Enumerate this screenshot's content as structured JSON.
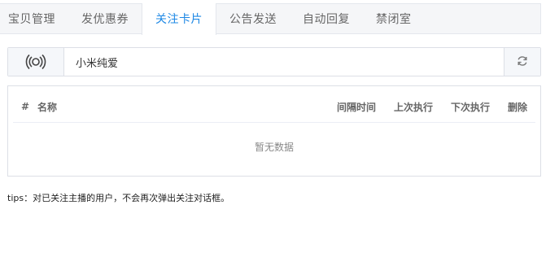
{
  "tabs": [
    {
      "label": "宝贝管理"
    },
    {
      "label": "发优惠券"
    },
    {
      "label": "关注卡片",
      "active": true
    },
    {
      "label": "公告发送"
    },
    {
      "label": "自动回复"
    },
    {
      "label": "禁闭室"
    }
  ],
  "search": {
    "value": "小米纯爱",
    "prefix_icon": "broadcast-icon",
    "suffix_icon": "refresh-icon"
  },
  "table": {
    "columns": {
      "hash": "#",
      "name": "名称",
      "interval": "间隔时间",
      "last": "上次执行",
      "next": "下次执行",
      "delete": "删除"
    },
    "empty_text": "暂无数据"
  },
  "tips": "tips：对已关注主播的用户，不会再次弹出关注对话框。",
  "colors": {
    "accent": "#1e88e5"
  }
}
